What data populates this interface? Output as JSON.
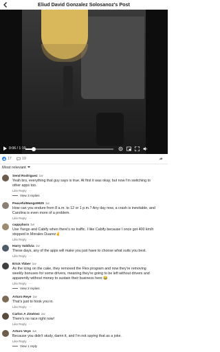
{
  "header": {
    "title": "Eliud David Gonzalez Solosanoz's Post"
  },
  "video": {
    "time": "0:06 / 1:10",
    "progress": 0.09
  },
  "stats": {
    "reactions": "17",
    "comments": "19"
  },
  "sort": {
    "label": "Most relevant"
  },
  "colors": {
    "accent": "#1877f2",
    "video_bg": "#0d0d0d",
    "yellow": "#d8b85a"
  },
  "comments": [
    {
      "name": "Send Rodriguez",
      "time": "1w",
      "text_lines": [
        "Yeah bro, everything that guy says is true. At first it was okay, but now I'm switching to",
        "other apps too."
      ],
      "like": "Like",
      "reply": "Reply",
      "replies": "View 3 replies",
      "avatar_color": "#6b5a4e"
    },
    {
      "name": "PeacefulMango9925",
      "time": "1w",
      "text_lines": [
        "How can you endure from 8 a.m. to 12 or 1 p.m.? Any day now, a crash is inevitable, and",
        "Carolina is even more of a problem."
      ],
      "like": "Like",
      "reply": "Reply",
      "replies": "",
      "avatar_color": "#8a7f72"
    },
    {
      "name": "cappybara",
      "time": "1w",
      "text_lines": [
        "Use Yango and Cabify when there's no traffic. I like Cabify because I once got 400 km/h",
        "stopped in Morales Duarez✌️"
      ],
      "like": "Like",
      "reply": "Reply",
      "replies": "",
      "avatar_color": "#9b8b6f"
    },
    {
      "name": "Harry Valdivia",
      "time": "1w",
      "text_lines": [
        "These days, any of the apps will make you just have to choose what suits you best."
      ],
      "like": "Like",
      "reply": "Reply",
      "replies": "",
      "avatar_color": "#4d5b6a"
    },
    {
      "name": "Erick Ybber",
      "time": "1w",
      "text_lines": [
        "As the icing on the cake, they removed the Flex program and now they're removing",
        "weekly bonuses for some drivers, meaning they're going to be left without drivers and",
        "apparently without money to sustain their business here 😂"
      ],
      "like": "Like",
      "reply": "Reply",
      "replies": "View 2 replies",
      "avatar_color": "#3f3f3f"
    },
    {
      "name": "Arturo Reye",
      "time": "1w",
      "text_lines": [
        "That's just to hook you in."
      ],
      "like": "Like",
      "reply": "Reply",
      "replies": "",
      "avatar_color": "#7d6a57"
    },
    {
      "name": "Carlos A Jiménez",
      "time": "1w",
      "text_lines": [
        "There's no race right now!"
      ],
      "like": "Like",
      "reply": "Reply",
      "replies": "",
      "avatar_color": "#5a4b3f"
    },
    {
      "name": "Arturo Veye",
      "time": "1w",
      "text_lines": [
        "Because you didn't study, damn it, and I'm not saying that as a joke."
      ],
      "like": "Like",
      "reply": "Reply",
      "replies": "View 1 reply",
      "avatar_color": "#6e5d4d"
    }
  ]
}
